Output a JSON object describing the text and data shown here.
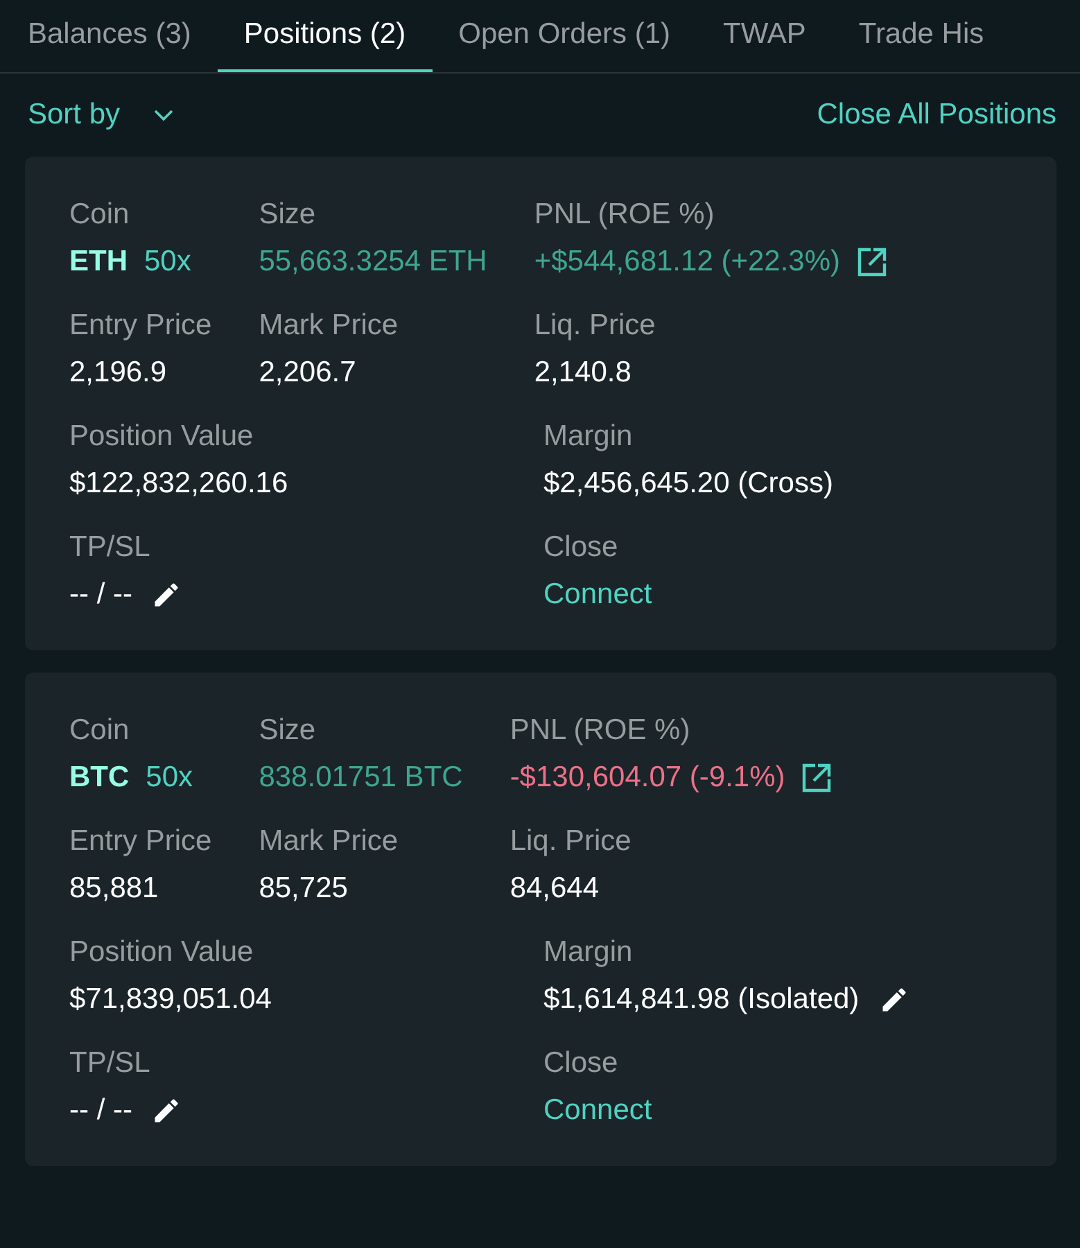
{
  "tabs": [
    {
      "label": "Balances (3)",
      "selected": false
    },
    {
      "label": "Positions (2)",
      "selected": true
    },
    {
      "label": "Open Orders (1)",
      "selected": false
    },
    {
      "label": "TWAP",
      "selected": false
    },
    {
      "label": "Trade His",
      "selected": false
    }
  ],
  "toolbar": {
    "sort_label": "Sort by",
    "close_all": "Close All Positions"
  },
  "positions": [
    {
      "top_fields": [
        {
          "kind": "coin",
          "label": "Coin",
          "value": "ETH",
          "leverage": "50x"
        },
        {
          "kind": "size",
          "label": "Size",
          "value": "55,663.3254 ETH"
        },
        {
          "kind": "pnl",
          "label": "PNL (ROE %)",
          "value": "+$544,681.12 (+22.3%)",
          "positive": true
        },
        {
          "kind": "plain",
          "label": "Entry Price",
          "value": "2,196.9"
        },
        {
          "kind": "plain",
          "label": "Mark Price",
          "value": "2,206.7"
        },
        {
          "kind": "plain",
          "label": "Liq. Price",
          "value": "2,140.8"
        }
      ],
      "bottom_fields": [
        {
          "kind": "plain",
          "label": "Position Value",
          "value": "$122,832,260.16"
        },
        {
          "kind": "margin",
          "label": "Margin",
          "value": "$2,456,645.20 (Cross)",
          "editable": false
        },
        {
          "kind": "tpsl",
          "label": "TP/SL",
          "value": "-- / --"
        },
        {
          "kind": "link",
          "label": "Close",
          "value": "Connect"
        }
      ]
    },
    {
      "top_fields": [
        {
          "kind": "coin",
          "label": "Coin",
          "value": "BTC",
          "leverage": "50x"
        },
        {
          "kind": "size",
          "label": "Size",
          "value": "838.01751 BTC"
        },
        {
          "kind": "pnl",
          "label": "PNL (ROE %)",
          "value": "-$130,604.07 (-9.1%)",
          "positive": false
        },
        {
          "kind": "plain",
          "label": "Entry Price",
          "value": "85,881"
        },
        {
          "kind": "plain",
          "label": "Mark Price",
          "value": "85,725"
        },
        {
          "kind": "plain",
          "label": "Liq. Price",
          "value": "84,644"
        }
      ],
      "bottom_fields": [
        {
          "kind": "plain",
          "label": "Position Value",
          "value": "$71,839,051.04"
        },
        {
          "kind": "margin",
          "label": "Margin",
          "value": "$1,614,841.98 (Isolated)",
          "editable": true
        },
        {
          "kind": "tpsl",
          "label": "TP/SL",
          "value": "-- / --"
        },
        {
          "kind": "link",
          "label": "Close",
          "value": "Connect"
        }
      ]
    }
  ]
}
